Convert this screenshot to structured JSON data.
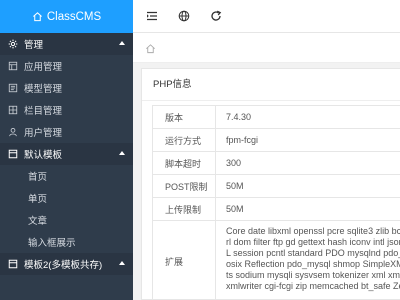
{
  "app": {
    "title": "ClassCMS"
  },
  "sidebar": {
    "groups": [
      {
        "label": "管理",
        "icon": "gear-icon",
        "items": [
          {
            "label": "应用管理",
            "icon": "app-icon"
          },
          {
            "label": "模型管理",
            "icon": "model-icon"
          },
          {
            "label": "栏目管理",
            "icon": "column-icon"
          },
          {
            "label": "用户管理",
            "icon": "user-icon"
          }
        ]
      },
      {
        "label": "默认模板",
        "icon": "template-icon",
        "items": [
          {
            "label": "首页"
          },
          {
            "label": "单页"
          },
          {
            "label": "文章"
          },
          {
            "label": "输入框展示"
          }
        ]
      },
      {
        "label": "模板2(多模板共存)",
        "icon": "template-icon",
        "items": []
      }
    ]
  },
  "header": {
    "icons": [
      "menu-toggle-icon",
      "globe-icon",
      "refresh-icon"
    ]
  },
  "content": {
    "card_title": "PHP信息",
    "rows": [
      {
        "label": "版本",
        "value": "7.4.30"
      },
      {
        "label": "运行方式",
        "value": "fpm-fcgi"
      },
      {
        "label": "脚本超时",
        "value": "300"
      },
      {
        "label": "POST限制",
        "value": "50M"
      },
      {
        "label": "上传限制",
        "value": "50M"
      }
    ],
    "extensions": {
      "label": "扩展",
      "lines": [
        "Core date libxml openssl pcre sqlite3 zlib bcmath",
        "rl dom filter ftp gd gettext hash iconv intl json mb",
        "L session pcntl standard PDO mysqlnd pdo_sqlit",
        "osix Reflection pdo_mysql shmop SimpleXML so",
        "ts sodium mysqli sysvsem tokenizer xml xmlread",
        "xmlwriter cgi-fcgi zip memcached bt_safe Zend O"
      ]
    }
  }
}
